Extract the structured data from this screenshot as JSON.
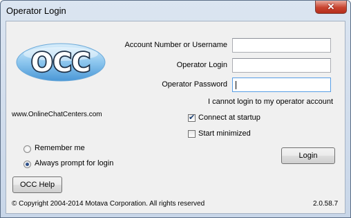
{
  "window": {
    "title": "Operator Login",
    "close_glyph": "✕"
  },
  "branding": {
    "logo_text": "OCC",
    "website": "www.OnlineChatCenters.com"
  },
  "form": {
    "account_label": "Account Number or Username",
    "account_value": "",
    "operator_login_label": "Operator Login",
    "operator_login_value": "",
    "password_label": "Operator Password",
    "password_value": "",
    "cannot_login_link": "I cannot login to my operator account"
  },
  "options": {
    "connect_at_startup": {
      "label": "Connect at startup",
      "checked": true
    },
    "start_minimized": {
      "label": "Start minimized",
      "checked": false
    }
  },
  "remember": {
    "remember_me": {
      "label": "Remember me",
      "selected": false
    },
    "always_prompt": {
      "label": "Always prompt for login",
      "selected": true
    }
  },
  "buttons": {
    "login": "Login",
    "help": "OCC Help"
  },
  "footer": {
    "copyright": "© Copyright 2004-2014  Motava Corporation. All rights reserved",
    "version": "2.0.58.7"
  }
}
